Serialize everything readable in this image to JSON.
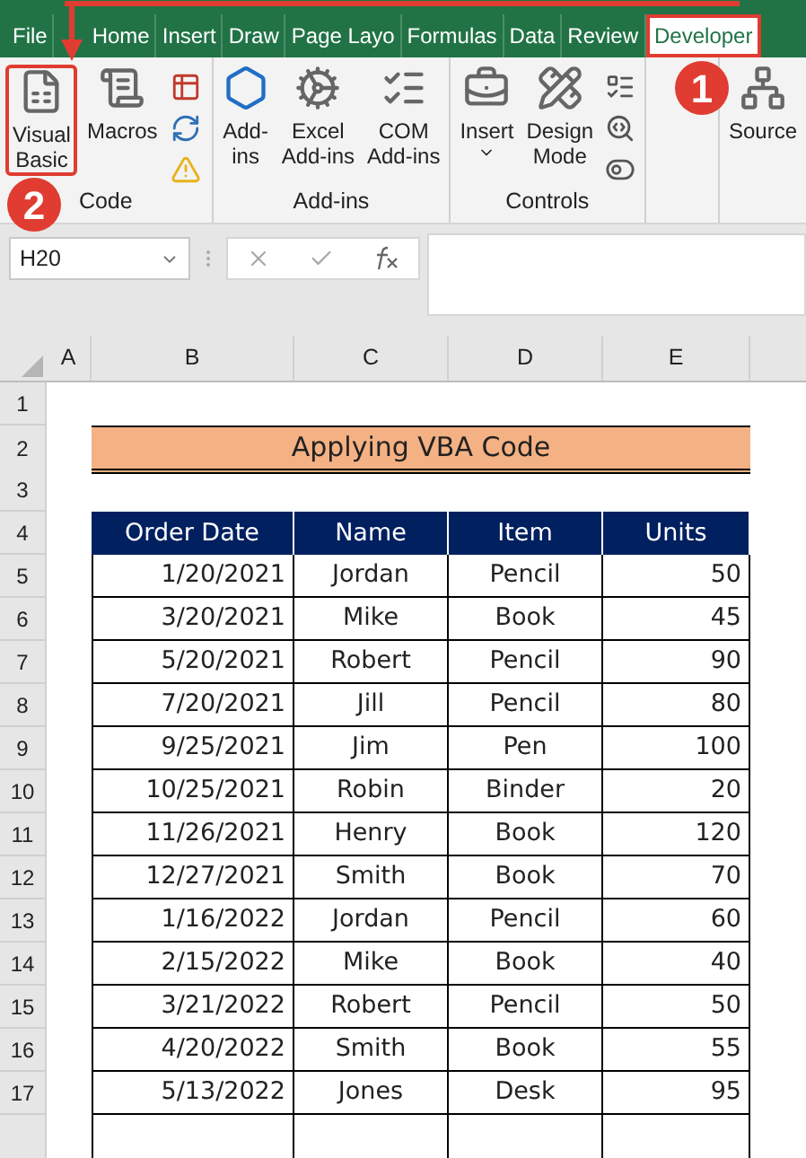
{
  "ribbon": {
    "tabs": [
      {
        "label": "File",
        "selected": false
      },
      {
        "label": "Home",
        "selected": false
      },
      {
        "label": "Insert",
        "selected": false
      },
      {
        "label": "Draw",
        "selected": false
      },
      {
        "label": "Page Layo",
        "selected": false
      },
      {
        "label": "Formulas",
        "selected": false
      },
      {
        "label": "Data",
        "selected": false
      },
      {
        "label": "Review",
        "selected": false
      },
      {
        "label": "Developer",
        "selected": true,
        "callout": "1"
      }
    ],
    "groups": [
      {
        "label": "Code",
        "items": [
          {
            "kind": "large",
            "label": "Visual\nBasic",
            "callout": "2"
          },
          {
            "kind": "large",
            "label": "Macros"
          },
          {
            "kind": "icon-stack"
          }
        ]
      },
      {
        "label": "Add-ins",
        "items": [
          {
            "kind": "large",
            "label": "Add-\nins"
          },
          {
            "kind": "large",
            "label": "Excel\nAdd-ins"
          },
          {
            "kind": "large",
            "label": "COM\nAdd-ins"
          }
        ]
      },
      {
        "label": "Controls",
        "items": [
          {
            "kind": "dropdown",
            "label": "Insert"
          },
          {
            "kind": "large",
            "label": "Design\nMode"
          },
          {
            "kind": "icon-stack"
          }
        ]
      },
      {
        "items": [
          {
            "kind": "large",
            "label": "Source"
          }
        ]
      }
    ]
  },
  "formula_bar": {
    "name_box": "H20"
  },
  "sheet": {
    "columns": [
      "A",
      "B",
      "C",
      "D",
      "E"
    ],
    "row_numbers": [
      "1",
      "2",
      "3",
      "4",
      "5",
      "6",
      "7",
      "8",
      "9",
      "10",
      "11",
      "12",
      "13",
      "14",
      "15",
      "16",
      "17"
    ],
    "title": "Applying VBA Code",
    "table": {
      "columns": [
        "Order Date",
        "Name",
        "Item",
        "Units"
      ],
      "rows": [
        [
          "1/20/2021",
          "Jordan",
          "Pencil",
          "50"
        ],
        [
          "3/20/2021",
          "Mike",
          "Book",
          "45"
        ],
        [
          "5/20/2021",
          "Robert",
          "Pencil",
          "90"
        ],
        [
          "7/20/2021",
          "Jill",
          "Pencil",
          "80"
        ],
        [
          "9/25/2021",
          "Jim",
          "Pen",
          "100"
        ],
        [
          "10/25/2021",
          "Robin",
          "Binder",
          "20"
        ],
        [
          "11/26/2021",
          "Henry",
          "Book",
          "120"
        ],
        [
          "12/27/2021",
          "Smith",
          "Book",
          "70"
        ],
        [
          "1/16/2022",
          "Jordan",
          "Pencil",
          "60"
        ],
        [
          "2/15/2022",
          "Mike",
          "Book",
          "40"
        ],
        [
          "3/21/2022",
          "Robert",
          "Pencil",
          "50"
        ],
        [
          "4/20/2022",
          "Smith",
          "Book",
          "55"
        ],
        [
          "5/13/2022",
          "Jones",
          "Desk",
          "95"
        ]
      ]
    }
  }
}
